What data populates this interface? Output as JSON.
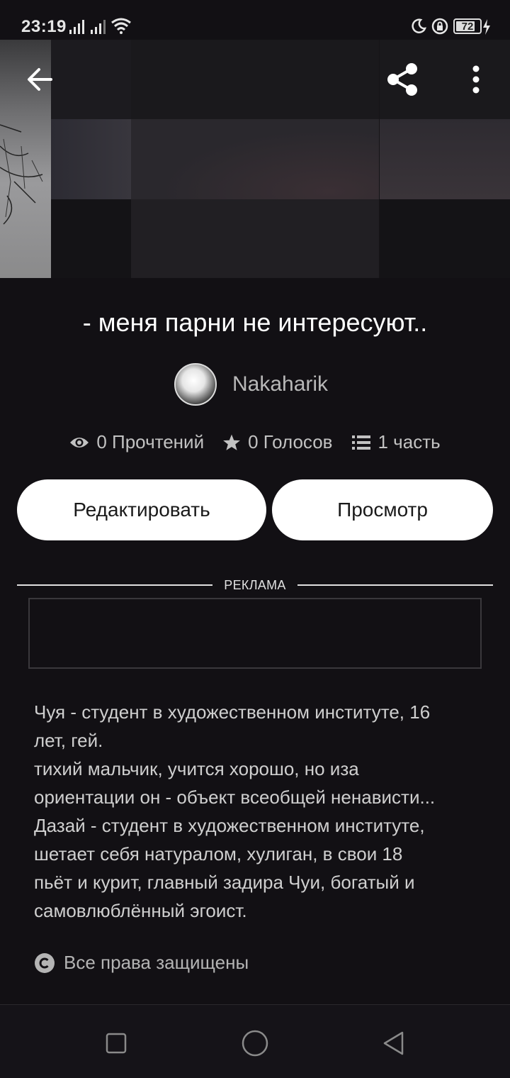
{
  "status_bar": {
    "time": "23:19",
    "battery": "72",
    "icons": [
      "signal-icon",
      "wifi-icon",
      "moon-icon",
      "lock-icon",
      "battery-icon",
      "charging-icon"
    ]
  },
  "toolbar": {
    "icons": [
      "back-arrow-icon",
      "share-icon",
      "more-vert-icon"
    ]
  },
  "story": {
    "title": "- меня парни не интересуют..",
    "author": "Nakaharik",
    "stats": {
      "reads": "0 Прочтений",
      "votes": "0 Голосов",
      "parts": "1 часть"
    }
  },
  "actions": {
    "edit_label": "Редактировать",
    "view_label": "Просмотр"
  },
  "ad": {
    "label": "РЕКЛАМА"
  },
  "description": {
    "lines": [
      "Чуя - студент в художественном институте, 16",
      "лет, гей.",
      "тихий мальчик, учится хорошо, но иза",
      "ориентации он - объект всеобщей ненависти...",
      "Дазай - студент в художественном институте,",
      "шетает себя натуралом, хулиган, в свои 18",
      "пьёт и курит, главный задира Чуи, богатый и",
      "самовлюблённый эгоист."
    ]
  },
  "copyright": {
    "label": "Все права защищены"
  },
  "nav_bar": {
    "icons": [
      "recents-square-icon",
      "home-circle-icon",
      "back-triangle-icon"
    ]
  }
}
